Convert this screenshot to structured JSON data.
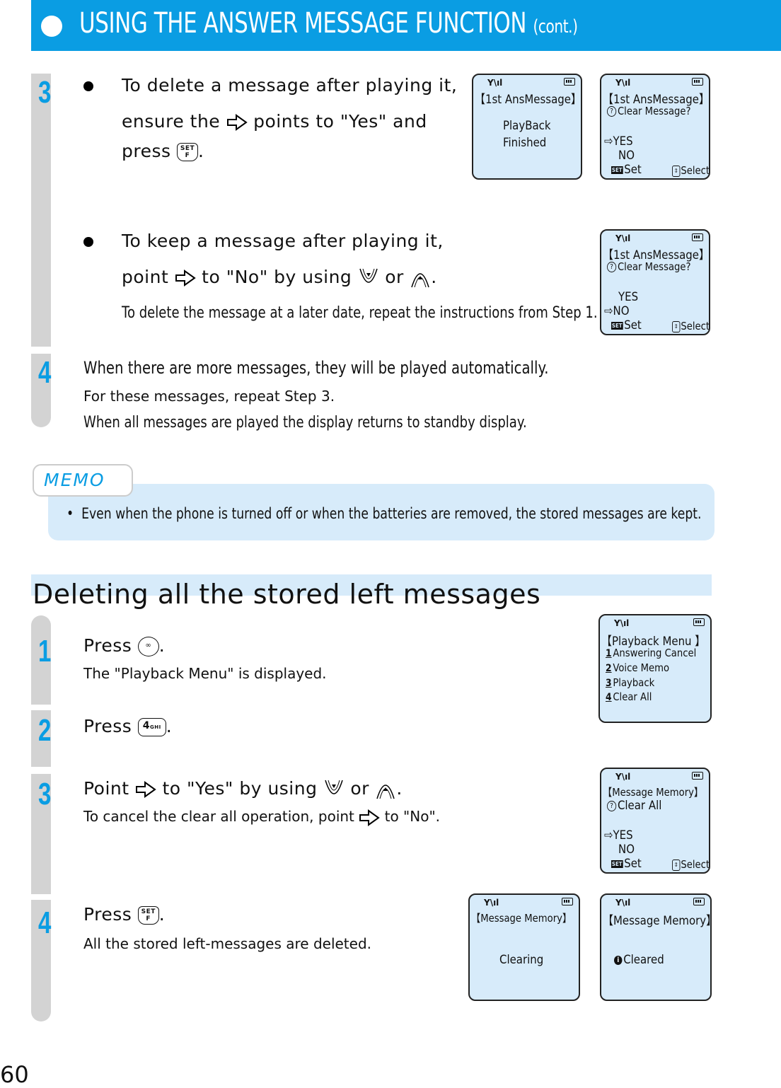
{
  "header": {
    "title": "USING THE ANSWER MESSAGE FUNCTION",
    "suffix": "(cont.)",
    "accent_color": "#0a9de3"
  },
  "section1": {
    "step3": {
      "number": "3",
      "bullet1": {
        "line1": "To delete a message after playing it,",
        "line2_pre": "ensure the",
        "line2_post": "points to \"Yes\" and",
        "line3_pre": "press",
        "line3_post": "."
      },
      "bullet2": {
        "line1": "To keep a message after playing it,",
        "line2_pre": "point",
        "line2_mid": "to \"No\" by using",
        "line2_or": "or",
        "line2_post": ".",
        "note": "To delete the message at a later date, repeat the instructions from Step 1."
      }
    },
    "step4": {
      "number": "4",
      "line1": "When there are more messages, they will be played automatically.",
      "line2": "For these messages, repeat Step 3.",
      "line3": "When all messages are played the display returns to standby display."
    }
  },
  "screens": {
    "s1": {
      "title": "【1st AnsMessage】",
      "line1": "PlayBack",
      "line2": "Finished"
    },
    "s2": {
      "title": "【1st AnsMessage】",
      "prompt": "Clear Message?",
      "opt_yes": "YES",
      "opt_no": "NO",
      "selected": "YES",
      "soft_left": "Set",
      "soft_right": "Select"
    },
    "s3": {
      "title": "【1st AnsMessage】",
      "prompt": "Clear Message?",
      "opt_yes": "YES",
      "opt_no": "NO",
      "selected": "NO",
      "soft_left": "Set",
      "soft_right": "Select"
    },
    "s4": {
      "title": "【Playback Menu 】",
      "items": [
        {
          "num": "1",
          "label": "Answering Cancel"
        },
        {
          "num": "2",
          "label": "Voice Memo"
        },
        {
          "num": "3",
          "label": "Playback"
        },
        {
          "num": "4",
          "label": "Clear All"
        }
      ]
    },
    "s5": {
      "title": "【Message Memory】",
      "prompt": "Clear All",
      "opt_yes": "YES",
      "opt_no": "NO",
      "selected": "YES",
      "soft_left": "Set",
      "soft_right": "Select"
    },
    "s6": {
      "title": "【Message Memory】",
      "line1": "Clearing"
    },
    "s7": {
      "title": "【Message Memory】",
      "line1": "Cleared"
    }
  },
  "memo": {
    "label": "MEMO",
    "items": [
      "Even when the phone is turned off or when the batteries are removed, the stored messages are kept."
    ]
  },
  "section2": {
    "title": "Deleting all the stored left messages",
    "step1": {
      "number": "1",
      "line1_pre": "Press",
      "line1_post": ".",
      "line2": "The \"Playback Menu\" is displayed."
    },
    "step2": {
      "number": "2",
      "line1_pre": "Press",
      "key": "4GHI",
      "line1_post": "."
    },
    "step3": {
      "number": "3",
      "line1_pre": "Point",
      "line1_mid": "to \"Yes\" by using",
      "line1_or": "or",
      "line1_post": ".",
      "line2_pre": "To cancel the clear all operation, point",
      "line2_post": "to \"No\"."
    },
    "step4": {
      "number": "4",
      "line1_pre": "Press",
      "line1_post": ".",
      "line2": "All the stored left-messages are deleted."
    }
  },
  "icons": {
    "pointer": "right-arrow-outline",
    "set_key": "SET/F",
    "down_key": "down-nav",
    "up_key": "up-nav",
    "answer_key": "voicemail-tape"
  },
  "page_number": "60"
}
